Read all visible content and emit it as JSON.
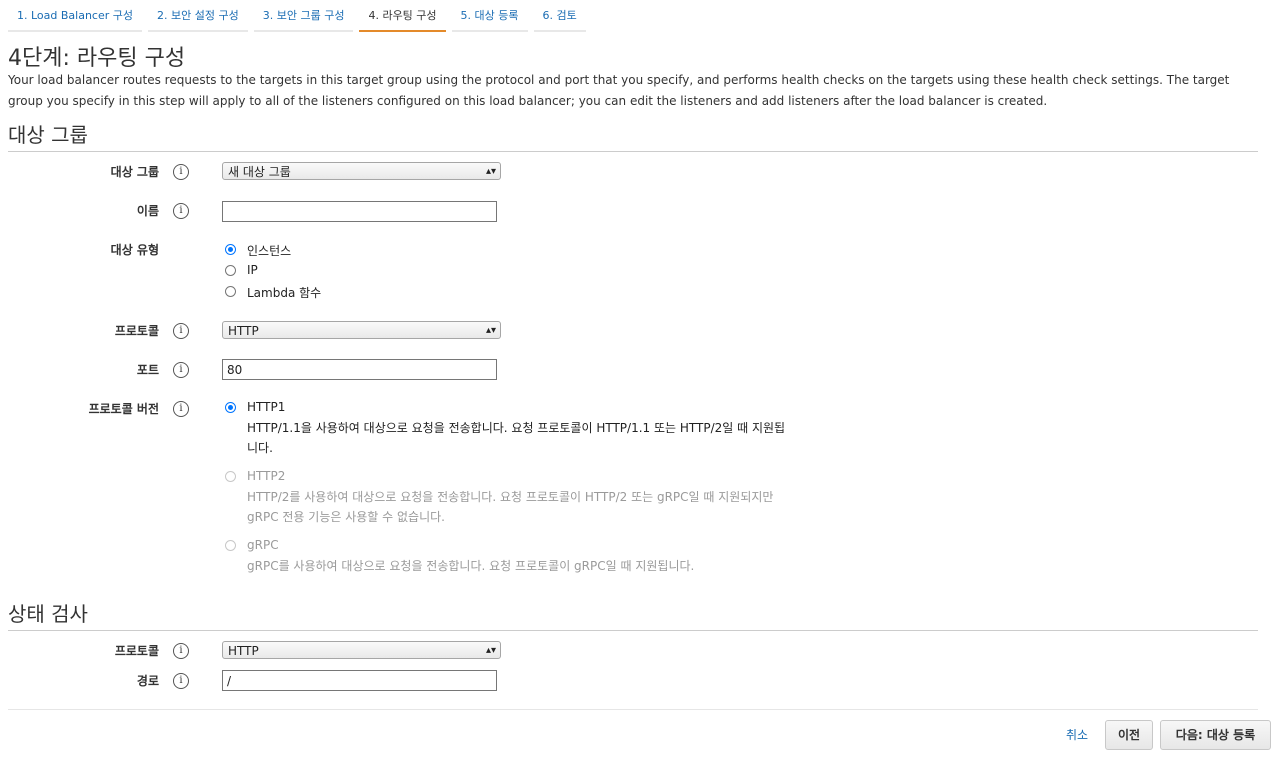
{
  "steps": [
    {
      "label": "1. Load Balancer 구성"
    },
    {
      "label": "2. 보안 설정 구성"
    },
    {
      "label": "3. 보안 그룹 구성"
    },
    {
      "label": "4. 라우팅 구성"
    },
    {
      "label": "5. 대상 등록"
    },
    {
      "label": "6. 검토"
    }
  ],
  "page": {
    "title": "4단계: 라우팅 구성",
    "description": "Your load balancer routes requests to the targets in this target group using the protocol and port that you specify, and performs health checks on the targets using these health check settings. The target group you specify in this step will apply to all of the listeners configured on this load balancer; you can edit the listeners and add listeners after the load balancer is created."
  },
  "target_group": {
    "section_title": "대상 그룹",
    "group_label": "대상 그룹",
    "group_value": "새 대상 그룹",
    "name_label": "이름",
    "name_value": "",
    "target_type_label": "대상 유형",
    "target_type_options": [
      "인스턴스",
      "IP",
      "Lambda 함수"
    ],
    "protocol_label": "프로토콜",
    "protocol_value": "HTTP",
    "port_label": "포트",
    "port_value": "80",
    "protocol_version_label": "프로토콜 버전",
    "versions": [
      {
        "label": "HTTP1",
        "desc_line1": "HTTP/1.1을 사용하여 대상으로 요청을 전송합니다. 요청 프로토콜이 HTTP/1.1 또는 HTTP/2일 때 지원됩",
        "desc_line2": "니다."
      },
      {
        "label": "HTTP2",
        "desc_line1": "HTTP/2를 사용하여 대상으로 요청을 전송합니다. 요청 프로토콜이 HTTP/2 또는 gRPC일 때 지원되지만",
        "desc_line2": "gRPC 전용 기능은 사용할 수 없습니다."
      },
      {
        "label": "gRPC",
        "desc_line1": "gRPC를 사용하여 대상으로 요청을 전송합니다. 요청 프로토콜이 gRPC일 때 지원됩니다.",
        "desc_line2": ""
      }
    ]
  },
  "health_check": {
    "section_title": "상태 검사",
    "protocol_label": "프로토콜",
    "protocol_value": "HTTP",
    "path_label": "경로",
    "path_value": "/"
  },
  "footer": {
    "cancel": "취소",
    "previous": "이전",
    "next": "다음: 대상 등록"
  },
  "icons": {
    "info": "info-icon",
    "caret": "select-caret-icon"
  },
  "colors": {
    "link": "#1a6cb3",
    "active_tab": "#e48a2a",
    "radio": "#0075ff"
  }
}
